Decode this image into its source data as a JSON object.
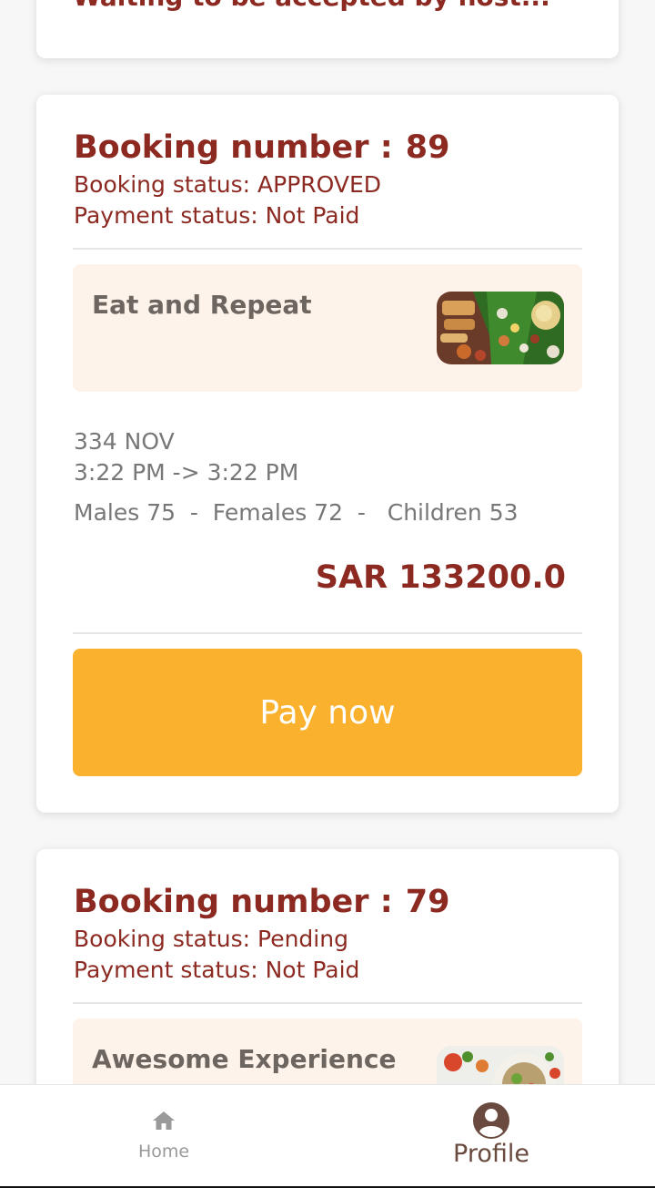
{
  "top_card": {
    "waiting_text": "Waiting to be accepted by host..."
  },
  "bookings": [
    {
      "booking_label": "Booking number :",
      "booking_number": "89",
      "booking_status": "Booking status: APPROVED",
      "payment_status": "Payment status: Not Paid",
      "experience_title": "Eat and Repeat",
      "date": "334 NOV",
      "time_range": "3:22 PM -> 3:22 PM",
      "guests": "Males 75  -  Females 72  -   Children 53",
      "price": "SAR 133200.0",
      "pay_label": "Pay now"
    },
    {
      "booking_label": "Booking number :",
      "booking_number": "79",
      "booking_status": "Booking status: Pending",
      "payment_status": "Payment status: Not Paid",
      "experience_title": "Awesome Experience"
    }
  ],
  "nav": {
    "home_label": "Home",
    "profile_label": "Profile"
  },
  "colors": {
    "brand": "#8c2a22",
    "pay_button": "#fab12d",
    "experience_bg": "#fdf3ea"
  }
}
